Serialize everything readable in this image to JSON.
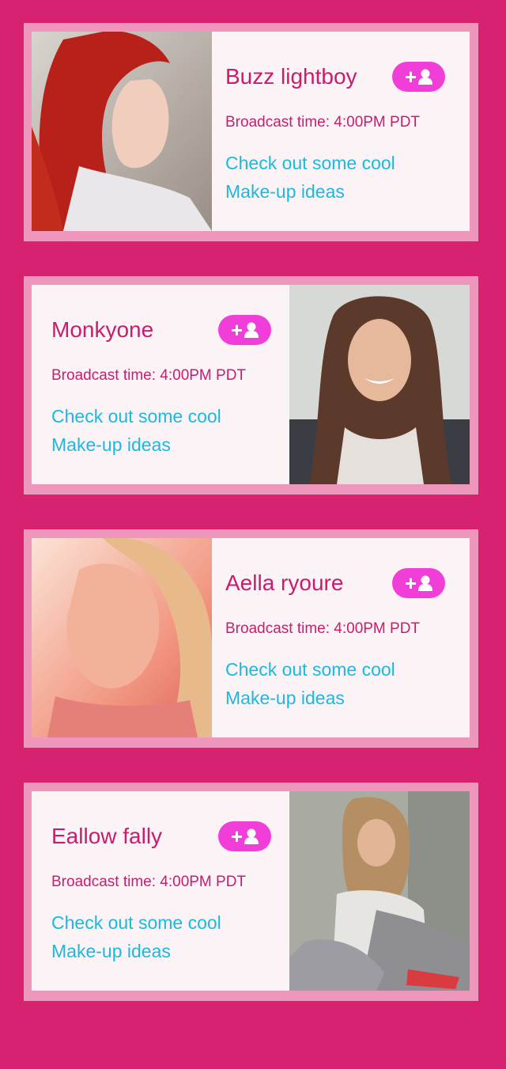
{
  "colors": {
    "page_background": "#d62271",
    "card_border": "#ef96bd",
    "card_background": "#fcf3f7",
    "name_text": "#c81d6d",
    "description_text": "#1ab9e0",
    "follow_button": "#f23ed8"
  },
  "follow_button": {
    "plus_glyph": "+",
    "icon": "user-icon"
  },
  "cards": [
    {
      "name": "Buzz lightboy",
      "broadcast": "Broadcast time: 4:00PM PDT",
      "description_line1": "Check out some cool",
      "description_line2": "Make-up ideas",
      "photo_position": "left",
      "photo_subject": "portrait-red-hair"
    },
    {
      "name": "Monkyone",
      "broadcast": "Broadcast time: 4:00PM PDT",
      "description_line1": "Check out some cool",
      "description_line2": "Make-up ideas",
      "photo_position": "right",
      "photo_subject": "portrait-brunette-smiling"
    },
    {
      "name": "Aella ryoure",
      "broadcast": "Broadcast time: 4:00PM PDT",
      "description_line1": "Check out some cool",
      "description_line2": "Make-up ideas",
      "photo_position": "left",
      "photo_subject": "portrait-blonde-warm-light"
    },
    {
      "name": "Eallow fally",
      "broadcast": "Broadcast time: 4:00PM PDT",
      "description_line1": "Check out some cool",
      "description_line2": "Make-up ideas",
      "photo_position": "right",
      "photo_subject": "portrait-seated-outdoor"
    }
  ]
}
